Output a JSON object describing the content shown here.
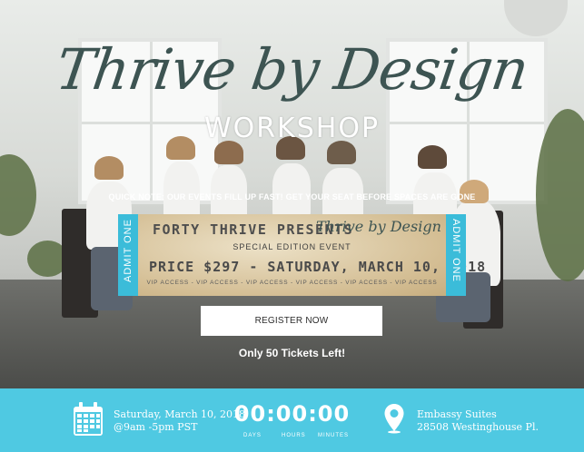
{
  "hero": {
    "title_script": "Thrive by Design",
    "subtitle": "WORKSHOP",
    "note": "QUICK NOTE: OUR EVENTS FILL UP FAST! GET YOUR SEAT BEFORE SPACES ARE GONE"
  },
  "ticket": {
    "stub_left": "ADMIT ONE",
    "stub_right": "ADMIT ONE",
    "presents": "FORTY THRIVE PRESENTS",
    "script": "Thrive by Design",
    "edition": "SPECIAL EDITION EVENT",
    "price_line": "PRICE $297 - SATURDAY, MARCH 10, 2018",
    "vip_line": "VIP ACCESS - VIP ACCESS - VIP ACCESS - VIP ACCESS - VIP ACCESS - VIP ACCESS",
    "stub_color": "#3bbcd9"
  },
  "cta": {
    "register_label": "REGISTER NOW",
    "tickets_left": "Only 50 Tickets Left!"
  },
  "footer": {
    "bg_color": "#4fc9e2",
    "date": "Saturday, March 10, 2018",
    "time": "@9am -5pm PST",
    "countdown": "00:00:00",
    "units": {
      "days": "DAYS",
      "hours": "HOURS",
      "minutes": "MINUTES"
    },
    "location_name": "Embassy Suites",
    "location_address": "28508 Westinghouse Pl.",
    "icons": [
      "calendar-icon",
      "location-pin-icon"
    ]
  }
}
